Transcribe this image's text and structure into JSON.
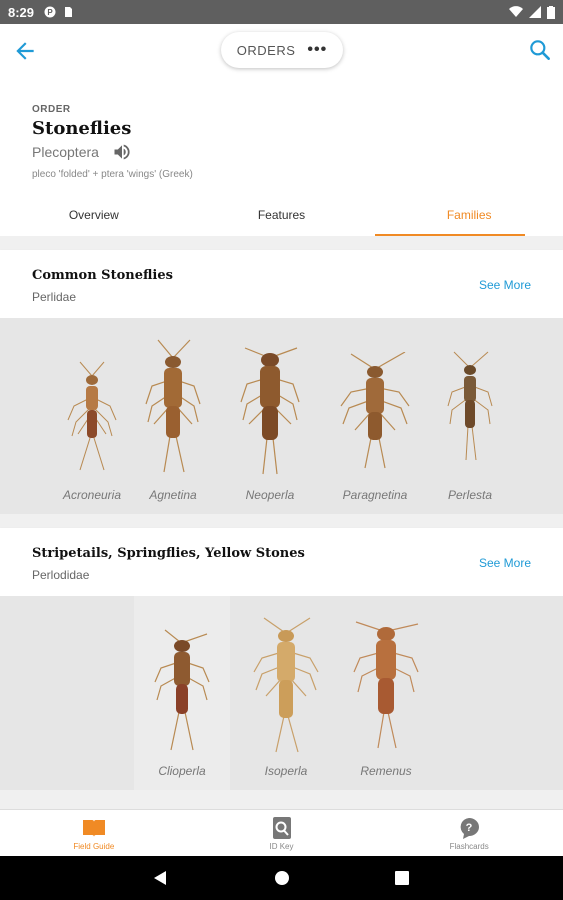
{
  "status_bar": {
    "time": "8:29"
  },
  "app_bar": {
    "title": "ORDERS",
    "more": "•••"
  },
  "header": {
    "label": "ORDER",
    "title": "Stoneflies",
    "scientific_name": "Plecoptera",
    "etymology": "pleco 'folded' + ptera 'wings' (Greek)"
  },
  "tabs": [
    {
      "label": "Overview"
    },
    {
      "label": "Features"
    },
    {
      "label": "Families"
    }
  ],
  "families": [
    {
      "title": "Common Stoneflies",
      "scientific_name": "Perlidae",
      "see_more": "See More",
      "genera": [
        "Acroneuria",
        "Agnetina",
        "Neoperla",
        "Paragnetina",
        "Perlesta"
      ]
    },
    {
      "title": "Stripetails, Springflies, Yellow Stones",
      "scientific_name": "Perlodidae",
      "see_more": "See More",
      "genera": [
        "Clioperla",
        "Isoperla",
        "Remenus"
      ]
    }
  ],
  "bottom_nav": [
    {
      "label": "Field Guide"
    },
    {
      "label": "ID Key"
    },
    {
      "label": "Flashcards"
    }
  ],
  "colors": {
    "accent": "#f08a24",
    "link": "#1f9ad6"
  }
}
